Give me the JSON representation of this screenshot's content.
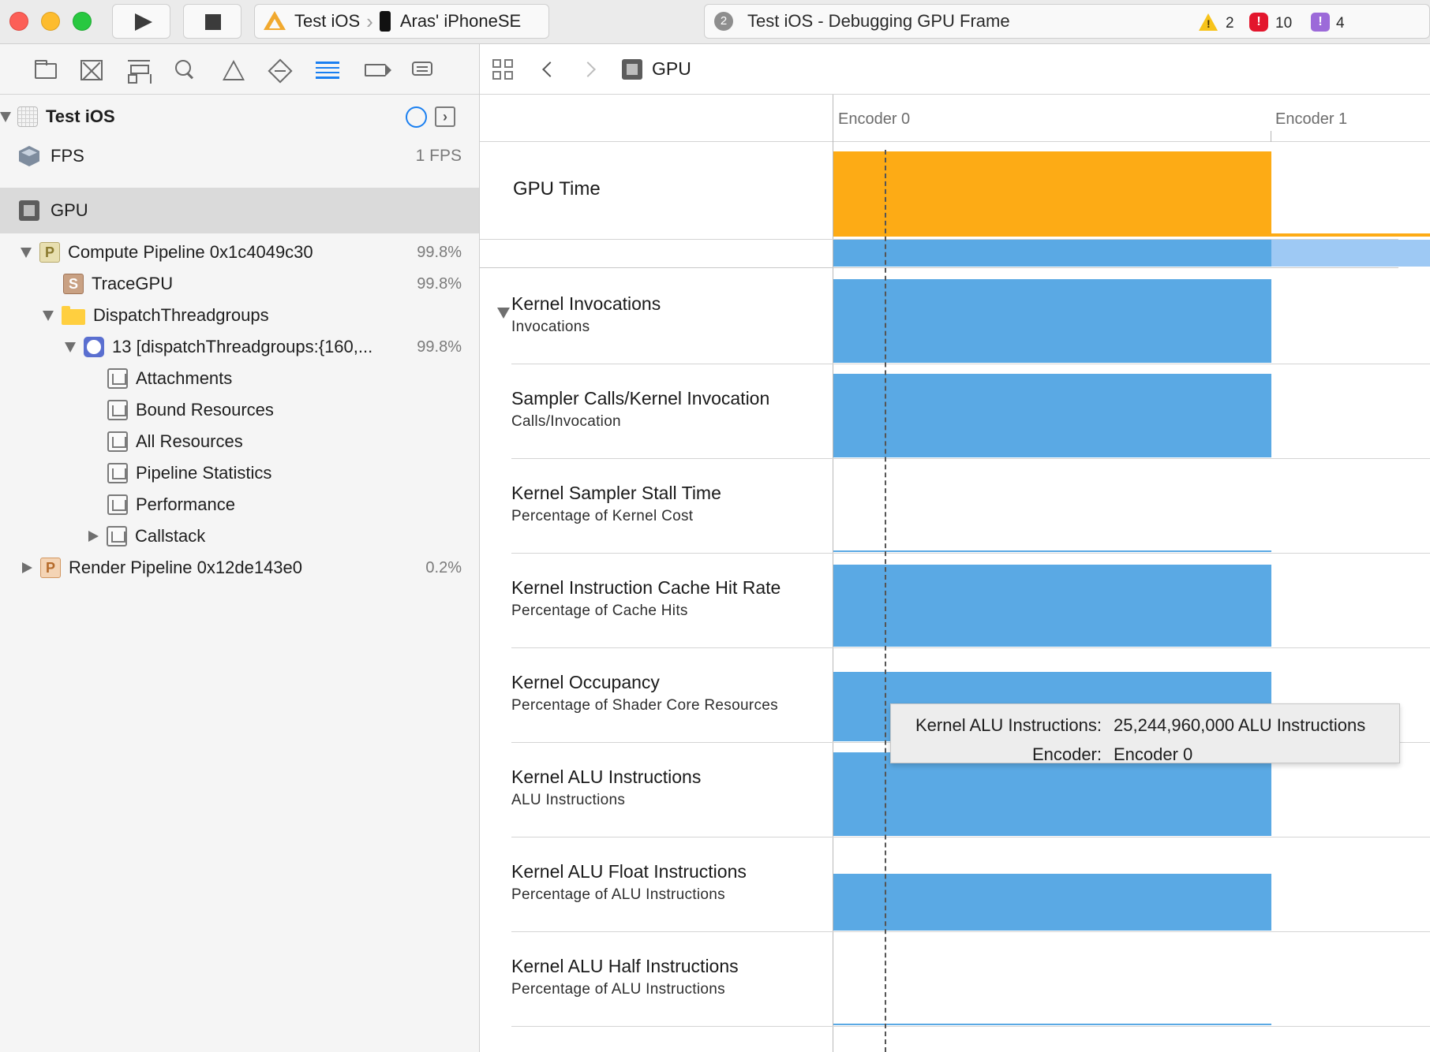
{
  "toolbar": {
    "scheme_name": "Test iOS",
    "device_name": "Aras' iPhoneSE",
    "activity_badge": "2",
    "activity_text": "Test iOS - Debugging GPU Frame",
    "warnings_count": "2",
    "errors_count": "10",
    "extra_glyph": "!",
    "extra_count": "4"
  },
  "navigator": {
    "project": {
      "label": "Test iOS"
    },
    "fps": {
      "label": "FPS",
      "value": "1 FPS"
    },
    "gpu": {
      "label": "GPU"
    },
    "compute_pipeline": {
      "label": "Compute Pipeline 0x1c4049c30",
      "value": "99.8%"
    },
    "trace_gpu": {
      "label": "TraceGPU",
      "value": "99.8%"
    },
    "dispatch_group": {
      "label": "DispatchThreadgroups"
    },
    "dispatch_call": {
      "label": "13 [dispatchThreadgroups:{160,...",
      "value": "99.8%"
    },
    "attachments": {
      "label": "Attachments"
    },
    "bound_resources": {
      "label": "Bound Resources"
    },
    "all_resources": {
      "label": "All Resources"
    },
    "pipeline_statistics": {
      "label": "Pipeline Statistics"
    },
    "performance": {
      "label": "Performance"
    },
    "callstack": {
      "label": "Callstack"
    },
    "render_pipeline": {
      "label": "Render Pipeline 0x12de143e0",
      "value": "0.2%"
    }
  },
  "editor": {
    "breadcrumb": "GPU",
    "encoder0": "Encoder 0",
    "encoder1": "Encoder 1",
    "lanes": {
      "gpu_time": {
        "title": "GPU Time"
      },
      "kernel_invocations": {
        "title": "Kernel Invocations",
        "subtitle": "Invocations"
      },
      "sampler_calls": {
        "title": "Sampler Calls/Kernel Invocation",
        "subtitle": "Calls/Invocation"
      },
      "sampler_stall": {
        "title": "Kernel Sampler Stall Time",
        "subtitle": "Percentage of Kernel Cost"
      },
      "icache_hit": {
        "title": "Kernel Instruction Cache Hit Rate",
        "subtitle": "Percentage of Cache Hits"
      },
      "occupancy": {
        "title": "Kernel Occupancy",
        "subtitle": "Percentage of Shader Core Resources"
      },
      "alu": {
        "title": "Kernel ALU Instructions",
        "subtitle": "ALU Instructions"
      },
      "alu_float": {
        "title": "Kernel ALU Float Instructions",
        "subtitle": "Percentage of ALU Instructions"
      },
      "alu_half": {
        "title": "Kernel ALU Half Instructions",
        "subtitle": "Percentage of ALU Instructions"
      }
    },
    "tooltip": {
      "metric_key": "Kernel ALU Instructions:",
      "metric_value": "25,244,960,000 ALU Instructions",
      "encoder_key": "Encoder:",
      "encoder_value": "Encoder 0"
    }
  },
  "colors": {
    "gpu_time_bar": "#fdab15",
    "metric_bar": "#5aa9e4",
    "metric_bar_light": "#9ec9f4",
    "selection": "#dadada",
    "accent": "#1a7ff0"
  }
}
